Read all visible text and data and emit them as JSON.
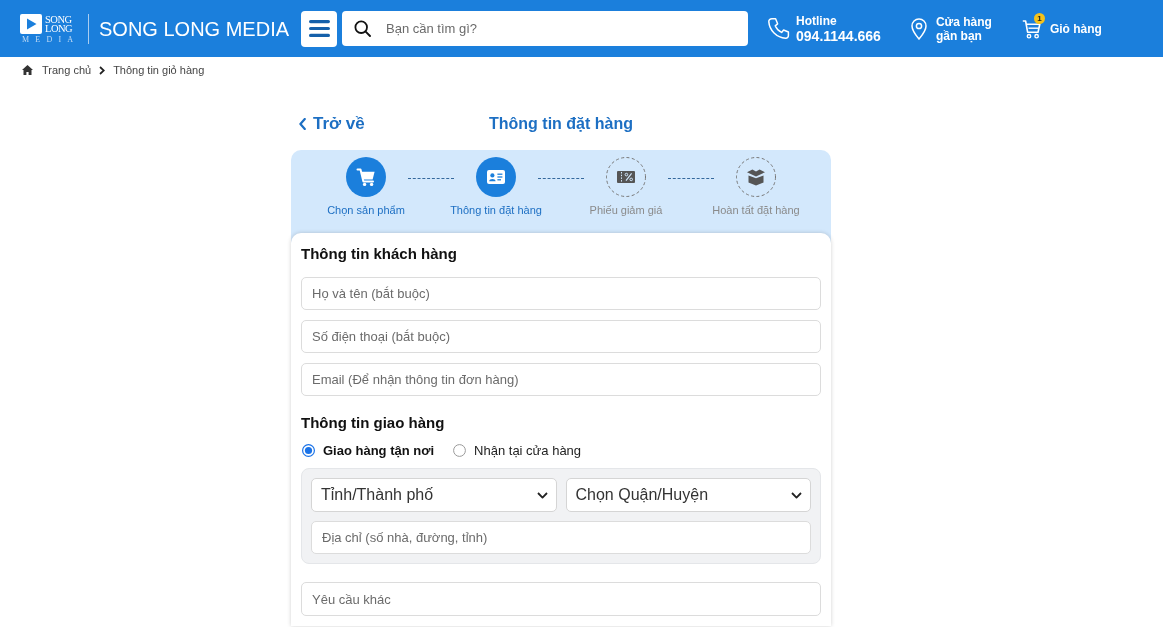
{
  "header": {
    "logo": {
      "wordmark": "SONG LONG",
      "tagline": "MEDIA",
      "site_name": "SONG LONG MEDIA"
    },
    "search": {
      "placeholder": "Bạn cần tìm gì?"
    },
    "hotline": {
      "label": "Hotline",
      "number": "094.1144.666"
    },
    "store_finder": {
      "label": "Cửa hàng gần bạn"
    },
    "cart": {
      "label": "Giỏ hàng",
      "badge": "1"
    }
  },
  "breadcrumb": [
    {
      "label": "Trang chủ"
    },
    {
      "label": "Thông tin giỏ hàng"
    }
  ],
  "page": {
    "back_link": "Trở về",
    "title": "Thông tin đặt hàng"
  },
  "steps": [
    {
      "label": "Chọn sản phẩm",
      "active": true
    },
    {
      "label": "Thông tin đặt hàng",
      "active": true
    },
    {
      "label": "Phiếu giảm giá",
      "active": false
    },
    {
      "label": "Hoàn tất đặt hàng",
      "active": false
    }
  ],
  "customer_info": {
    "heading": "Thông tin khách hàng",
    "fields": [
      {
        "placeholder": "Họ và tên (bắt buộc)"
      },
      {
        "placeholder": "Số điện thoại (bắt buộc)"
      },
      {
        "placeholder": "Email (Để nhận thông tin đơn hàng)"
      }
    ]
  },
  "shipping_info": {
    "heading": "Thông tin giao hàng",
    "delivery_options": [
      {
        "label": "Giao hàng tận nơi",
        "selected": true
      },
      {
        "label": "Nhận tại cửa hàng",
        "selected": false
      }
    ],
    "province_select": {
      "value": "Tỉnh/Thành phố"
    },
    "district_select": {
      "value": "Chọn Quận/Huyện"
    },
    "address": {
      "placeholder": "Địa chỉ (số nhà, đường, tỉnh)"
    },
    "other_request": {
      "placeholder": "Yêu cầu khác"
    }
  }
}
